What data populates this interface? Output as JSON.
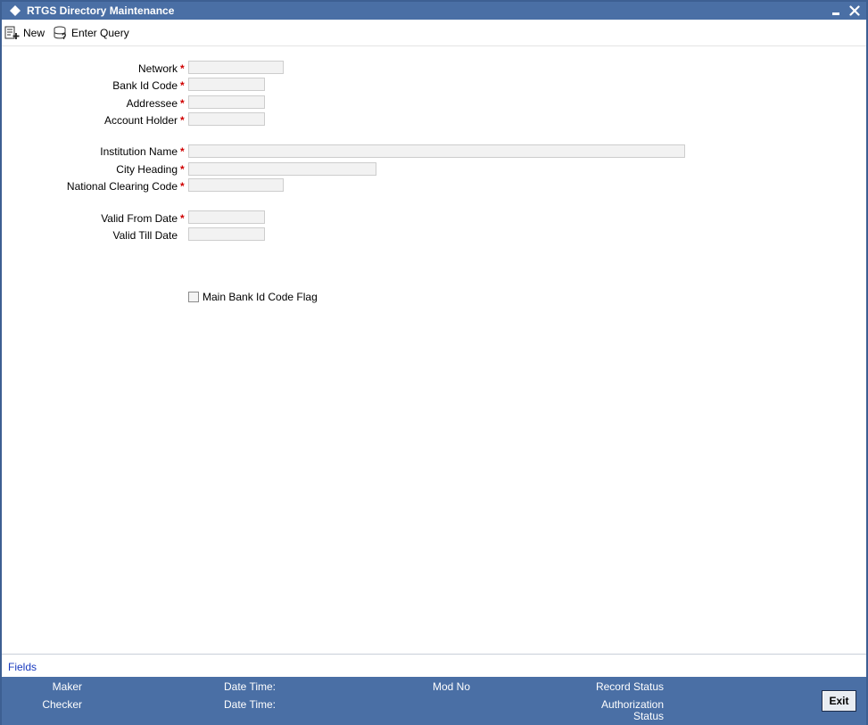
{
  "window": {
    "title": "RTGS Directory Maintenance",
    "minimize_icon": "minimize-icon",
    "close_icon": "close-icon"
  },
  "toolbar": {
    "new_label": "New",
    "enter_query_label": "Enter Query"
  },
  "form": {
    "network_label": "Network",
    "bank_id_code_label": "Bank Id Code",
    "addressee_label": "Addressee",
    "account_holder_label": "Account Holder",
    "institution_name_label": "Institution Name",
    "city_heading_label": "City Heading",
    "national_clearing_code_label": "National Clearing Code",
    "valid_from_date_label": "Valid From Date",
    "valid_till_date_label": "Valid Till Date",
    "main_bank_flag_label": "Main Bank Id Code Flag",
    "required_marker": "*",
    "values": {
      "network": "",
      "bank_id_code": "",
      "addressee": "",
      "account_holder": "",
      "institution_name": "",
      "city_heading": "",
      "national_clearing_code": "",
      "valid_from_date": "",
      "valid_till_date": ""
    },
    "main_bank_flag_checked": false
  },
  "fields_link": "Fields",
  "footer": {
    "maker_label": "Maker",
    "checker_label": "Checker",
    "date_time_label": "Date Time:",
    "mod_no_label": "Mod No",
    "record_status_label": "Record Status",
    "authorization_label": "Authorization",
    "status_label": "Status",
    "exit_label": "Exit"
  },
  "colors": {
    "frame": "#4a6fa5",
    "required": "#d00000",
    "link": "#1a3bbf"
  }
}
